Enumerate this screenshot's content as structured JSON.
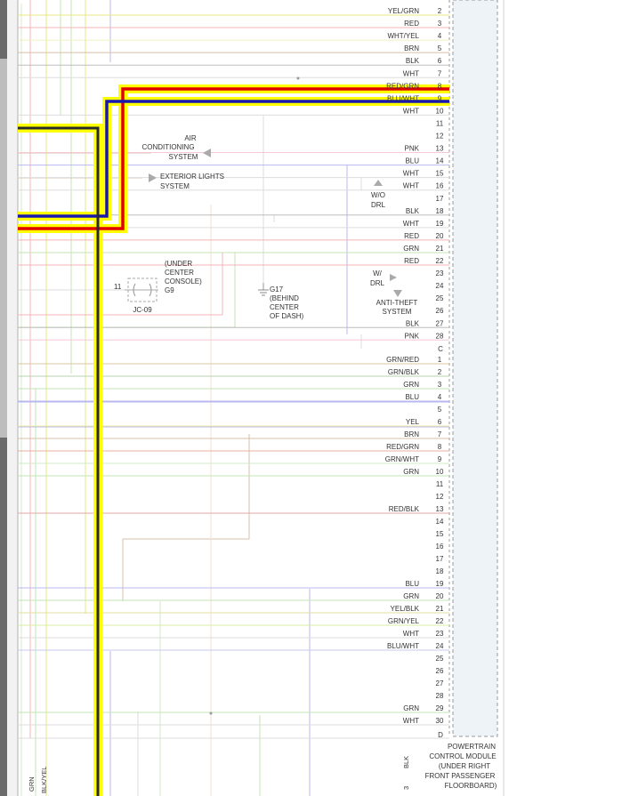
{
  "colors": {
    "page_bg": "#ffffff",
    "left_chrome": "#6b6b6b",
    "scrollbar": "#bdbdbd",
    "module_fill": "#eef3f8",
    "harness_highlight": "#ffff00",
    "wire_red": "#e00000",
    "wire_blue": "#1818b0",
    "wire_black": "#2a2a2a"
  },
  "connector_b": {
    "pins": [
      {
        "pin": "2",
        "color": "YEL/GRN",
        "wire": "#e8e880"
      },
      {
        "pin": "3",
        "color": "RED",
        "wire": "#f4b4b4"
      },
      {
        "pin": "4",
        "color": "WHT/YEL",
        "wire": "#f0f0c0"
      },
      {
        "pin": "5",
        "color": "BRN",
        "wire": "#d8bfa8"
      },
      {
        "pin": "6",
        "color": "BLK",
        "wire": "#bdbdbd"
      },
      {
        "pin": "7",
        "color": "WHT",
        "wire": "#dddddd"
      },
      {
        "pin": "8",
        "color": "RED/GRN",
        "wire": "#e00000",
        "emph": true
      },
      {
        "pin": "9",
        "color": "BLU/WHT",
        "wire": "#1818b0",
        "emph": true
      },
      {
        "pin": "10",
        "color": "WHT",
        "wire": "#dddddd"
      },
      {
        "pin": "11",
        "color": "",
        "wire": ""
      },
      {
        "pin": "12",
        "color": "",
        "wire": ""
      },
      {
        "pin": "13",
        "color": "PNK",
        "wire": "#f5c8d8"
      },
      {
        "pin": "14",
        "color": "BLU",
        "wire": "#b8b8f0"
      },
      {
        "pin": "15",
        "color": "WHT",
        "wire": "#dddddd"
      },
      {
        "pin": "16",
        "color": "WHT",
        "wire": "#dddddd"
      },
      {
        "pin": "17",
        "color": "",
        "wire": ""
      },
      {
        "pin": "18",
        "color": "BLK",
        "wire": "#bdbdbd"
      },
      {
        "pin": "19",
        "color": "WHT",
        "wire": "#dddddd"
      },
      {
        "pin": "20",
        "color": "RED",
        "wire": "#f4b4b4"
      },
      {
        "pin": "21",
        "color": "GRN",
        "wire": "#c4e4b4"
      },
      {
        "pin": "22",
        "color": "RED",
        "wire": "#f4b4b4"
      },
      {
        "pin": "23",
        "color": "",
        "wire": ""
      },
      {
        "pin": "24",
        "color": "",
        "wire": ""
      },
      {
        "pin": "25",
        "color": "",
        "wire": ""
      },
      {
        "pin": "26",
        "color": "",
        "wire": ""
      },
      {
        "pin": "27",
        "color": "BLK",
        "wire": "#bdbdbd"
      },
      {
        "pin": "28",
        "color": "PNK",
        "wire": "#f5c8d8"
      }
    ]
  },
  "connector_c": {
    "label": "C",
    "pins": [
      {
        "pin": "1",
        "color": "GRN/RED",
        "wire": "#d8c8a0"
      },
      {
        "pin": "2",
        "color": "GRN/BLK",
        "wire": "#b8d0b0"
      },
      {
        "pin": "3",
        "color": "GRN",
        "wire": "#c4e4b4"
      },
      {
        "pin": "4",
        "color": "BLU",
        "wire": "#b8b8f0"
      },
      {
        "pin": "5",
        "color": "",
        "wire": ""
      },
      {
        "pin": "6",
        "color": "YEL",
        "wire": "#f0f0a0"
      },
      {
        "pin": "7",
        "color": "BRN",
        "wire": "#d8bfa8"
      },
      {
        "pin": "8",
        "color": "RED/GRN",
        "wire": "#e8b0a0"
      },
      {
        "pin": "9",
        "color": "GRN/WHT",
        "wire": "#d0e8c8"
      },
      {
        "pin": "10",
        "color": "GRN",
        "wire": "#c4e4b4"
      },
      {
        "pin": "11",
        "color": "",
        "wire": ""
      },
      {
        "pin": "12",
        "color": "",
        "wire": ""
      },
      {
        "pin": "13",
        "color": "RED/BLK",
        "wire": "#e0a8a8"
      },
      {
        "pin": "14",
        "color": "",
        "wire": ""
      },
      {
        "pin": "15",
        "color": "",
        "wire": ""
      },
      {
        "pin": "16",
        "color": "",
        "wire": ""
      },
      {
        "pin": "17",
        "color": "",
        "wire": ""
      },
      {
        "pin": "18",
        "color": "",
        "wire": ""
      },
      {
        "pin": "19",
        "color": "BLU",
        "wire": "#b8b8f0"
      },
      {
        "pin": "20",
        "color": "GRN",
        "wire": "#c4e4b4"
      },
      {
        "pin": "21",
        "color": "YEL/BLK",
        "wire": "#e0e0a0"
      },
      {
        "pin": "22",
        "color": "GRN/YEL",
        "wire": "#d8eca0"
      },
      {
        "pin": "23",
        "color": "WHT",
        "wire": "#dddddd"
      },
      {
        "pin": "24",
        "color": "BLU/WHT",
        "wire": "#c8c8f0"
      },
      {
        "pin": "25",
        "color": "",
        "wire": ""
      },
      {
        "pin": "26",
        "color": "",
        "wire": ""
      },
      {
        "pin": "27",
        "color": "",
        "wire": ""
      },
      {
        "pin": "28",
        "color": "",
        "wire": ""
      },
      {
        "pin": "29",
        "color": "GRN",
        "wire": "#c4e4b4"
      },
      {
        "pin": "30",
        "color": "WHT",
        "wire": "#dddddd"
      }
    ]
  },
  "connector_d": {
    "label": "D"
  },
  "module": {
    "name_lines": [
      "POWERTRAIN",
      "CONTROL MODULE",
      "(UNDER RIGHT",
      "FRONT PASSENGER",
      "FLOORBOARD)"
    ]
  },
  "references": {
    "ac": {
      "lines": [
        "AIR",
        "CONDITIONING",
        "SYSTEM"
      ]
    },
    "ext_lights": {
      "lines": [
        "EXTERIOR LIGHTS",
        "SYSTEM"
      ]
    },
    "anti_theft": {
      "lines": [
        "ANTI-THEFT",
        "SYSTEM"
      ]
    }
  },
  "notes": {
    "wo_drl": {
      "lines": [
        "W/O",
        "DRL"
      ]
    },
    "w_drl": {
      "lines": [
        "W/",
        "DRL"
      ]
    }
  },
  "ground_g17": {
    "lines": [
      "G17",
      "(BEHIND",
      "CENTER",
      "OF DASH)"
    ]
  },
  "ground_g9": {
    "lines": [
      "(UNDER",
      "CENTER",
      "CONSOLE)",
      "G9"
    ]
  },
  "junction": {
    "label": "JC-09",
    "pin": "11"
  },
  "bottom_labels": {
    "left_wires": [
      "GRN",
      "BLK/YEL"
    ],
    "blk": "BLK",
    "pin3": "3"
  }
}
